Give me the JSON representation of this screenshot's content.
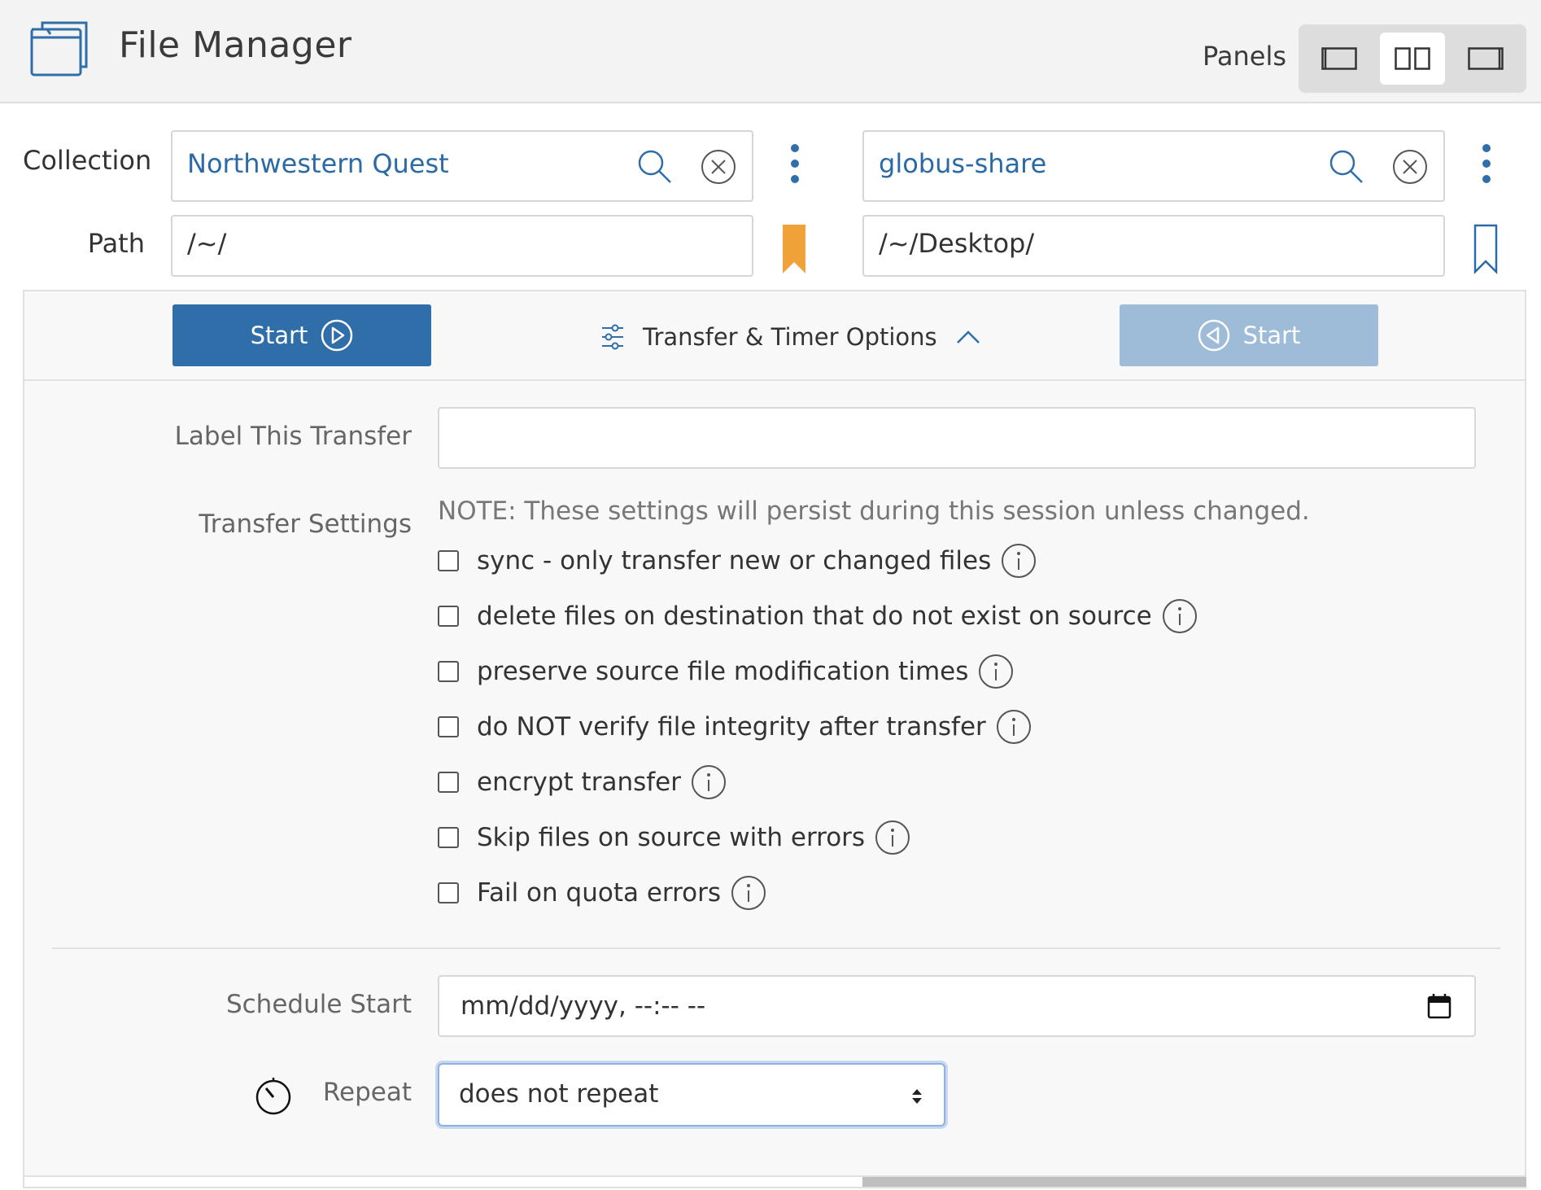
{
  "header": {
    "title": "File Manager",
    "panels_label": "Panels",
    "panel_options": [
      "single-panel",
      "dual-panel",
      "right-panel"
    ],
    "active_panel": "dual-panel"
  },
  "labels": {
    "collection": "Collection",
    "path": "Path"
  },
  "left": {
    "collection": "Northwestern Quest",
    "path": "/~/",
    "bookmark_color": "#f0a23a"
  },
  "right": {
    "collection": "globus-share",
    "path": "/~/Desktop/",
    "bookmark_color": "#2b6aa6"
  },
  "transfer_bar": {
    "start_left": "Start",
    "start_right": "Start",
    "options_label": "Transfer & Timer Options"
  },
  "options": {
    "label_transfer": "Label This Transfer",
    "label_transfer_value": "",
    "transfer_settings": "Transfer Settings",
    "note": "NOTE: These settings will persist during this session unless changed.",
    "checkboxes": [
      {
        "label": "sync - only transfer new or changed files",
        "checked": false
      },
      {
        "label": "delete files on destination that do not exist on source",
        "checked": false
      },
      {
        "label": "preserve source file modification times",
        "checked": false
      },
      {
        "label": "do NOT verify file integrity after transfer",
        "checked": false
      },
      {
        "label": "encrypt transfer",
        "checked": false
      },
      {
        "label": "Skip files on source with errors",
        "checked": false
      },
      {
        "label": "Fail on quota errors",
        "checked": false
      }
    ],
    "schedule_start": "Schedule Start",
    "schedule_placeholder": "mm/dd/yyyy, --:-- --",
    "repeat_label": "Repeat",
    "repeat_value": "does not repeat"
  },
  "colors": {
    "accent": "#2f6ea8",
    "accent_disabled": "#9ebbd7",
    "link": "#2b6aa6"
  }
}
